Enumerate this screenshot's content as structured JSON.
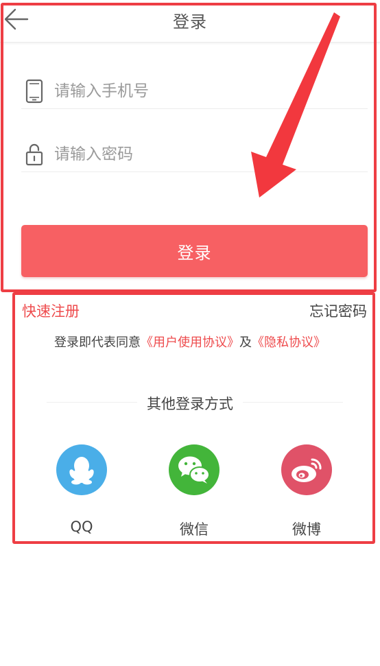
{
  "header": {
    "title": "登录",
    "back_icon": "arrow-left-icon"
  },
  "form": {
    "phone": {
      "placeholder": "请输入手机号",
      "value": "",
      "icon": "phone-icon"
    },
    "password": {
      "placeholder": "请输入密码",
      "value": "",
      "icon": "lock-icon"
    },
    "login_label": "登录"
  },
  "links": {
    "register": "快速注册",
    "forgot_password": "忘记密码"
  },
  "agreement": {
    "prefix": "登录即代表同意",
    "user_agreement": "《用户使用协议》",
    "connector": "及",
    "privacy_agreement": "《隐私协议》"
  },
  "other_login": {
    "title": "其他登录方式",
    "items": [
      {
        "label": "QQ",
        "icon": "qq-icon",
        "color": "#4aaee8"
      },
      {
        "label": "微信",
        "icon": "wechat-icon",
        "color": "#43b53a"
      },
      {
        "label": "微博",
        "icon": "weibo-icon",
        "color": "#e05268"
      }
    ]
  },
  "colors": {
    "accent": "#f76063",
    "link_red": "#ee4b4d",
    "annotation": "#ee3e44"
  }
}
